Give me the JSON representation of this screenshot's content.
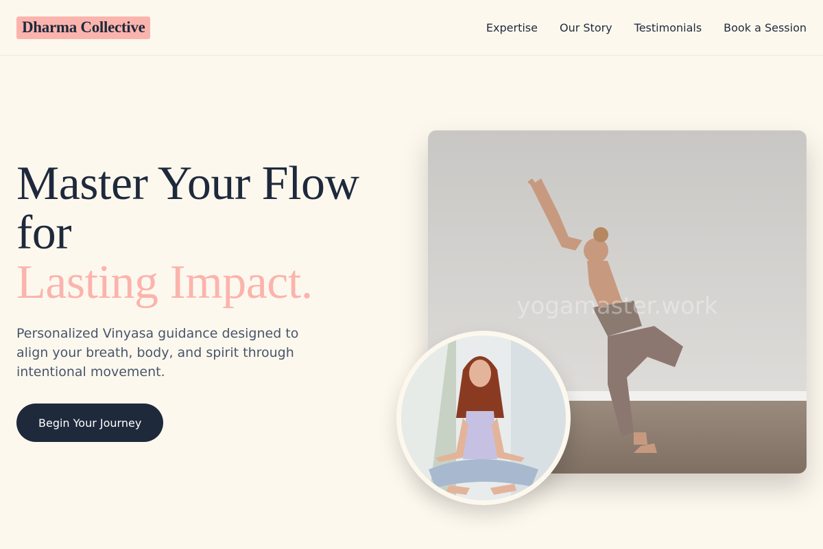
{
  "header": {
    "logo": "Dharma Collective",
    "nav": [
      "Expertise",
      "Our Story",
      "Testimonials",
      "Book a Session"
    ]
  },
  "hero": {
    "title_line1": "Master Your Flow",
    "title_line2": "for",
    "title_accent": "Lasting Impact.",
    "subtitle": "Personalized Vinyasa guidance designed to align your breath, body, and spirit through intentional movement.",
    "cta": "Begin Your Journey"
  },
  "images": {
    "main_watermark": "yogamaster.work"
  },
  "colors": {
    "background": "#fdf8ee",
    "accent": "#fbb4ad",
    "dark": "#1e293b",
    "muted": "#475569"
  }
}
